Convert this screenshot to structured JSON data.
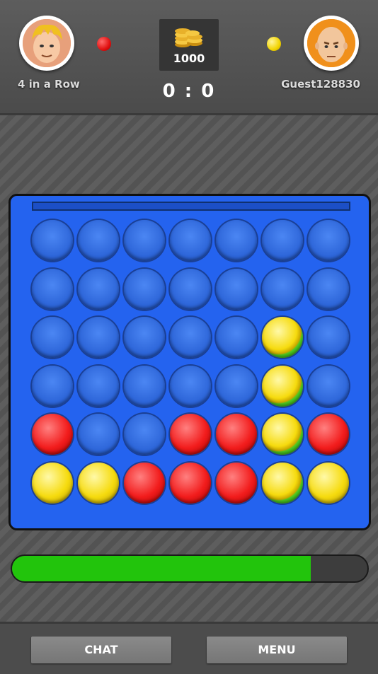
{
  "players": {
    "left": {
      "name": "4 in a Row",
      "color": "#e01010",
      "icon": "blond-boy-avatar"
    },
    "right": {
      "name": "Guest128830",
      "color": "#f2d400",
      "icon": "bald-man-avatar"
    }
  },
  "coins": {
    "value": "1000",
    "icon": "gold-coins-icon"
  },
  "score": "0 : 0",
  "board": {
    "rows": 6,
    "cols": 7,
    "cells": [
      [
        "empty",
        "empty",
        "empty",
        "empty",
        "empty",
        "empty",
        "empty"
      ],
      [
        "empty",
        "empty",
        "empty",
        "empty",
        "empty",
        "empty",
        "empty"
      ],
      [
        "empty",
        "empty",
        "empty",
        "empty",
        "empty",
        "win",
        "empty"
      ],
      [
        "empty",
        "empty",
        "empty",
        "empty",
        "empty",
        "win",
        "empty"
      ],
      [
        "red",
        "empty",
        "empty",
        "red",
        "red",
        "win",
        "red"
      ],
      [
        "yellow",
        "yellow",
        "red",
        "red",
        "red",
        "win",
        "yellow"
      ]
    ]
  },
  "timer": {
    "progress": 0.84
  },
  "buttons": {
    "chat": "CHAT",
    "menu": "MENU"
  }
}
